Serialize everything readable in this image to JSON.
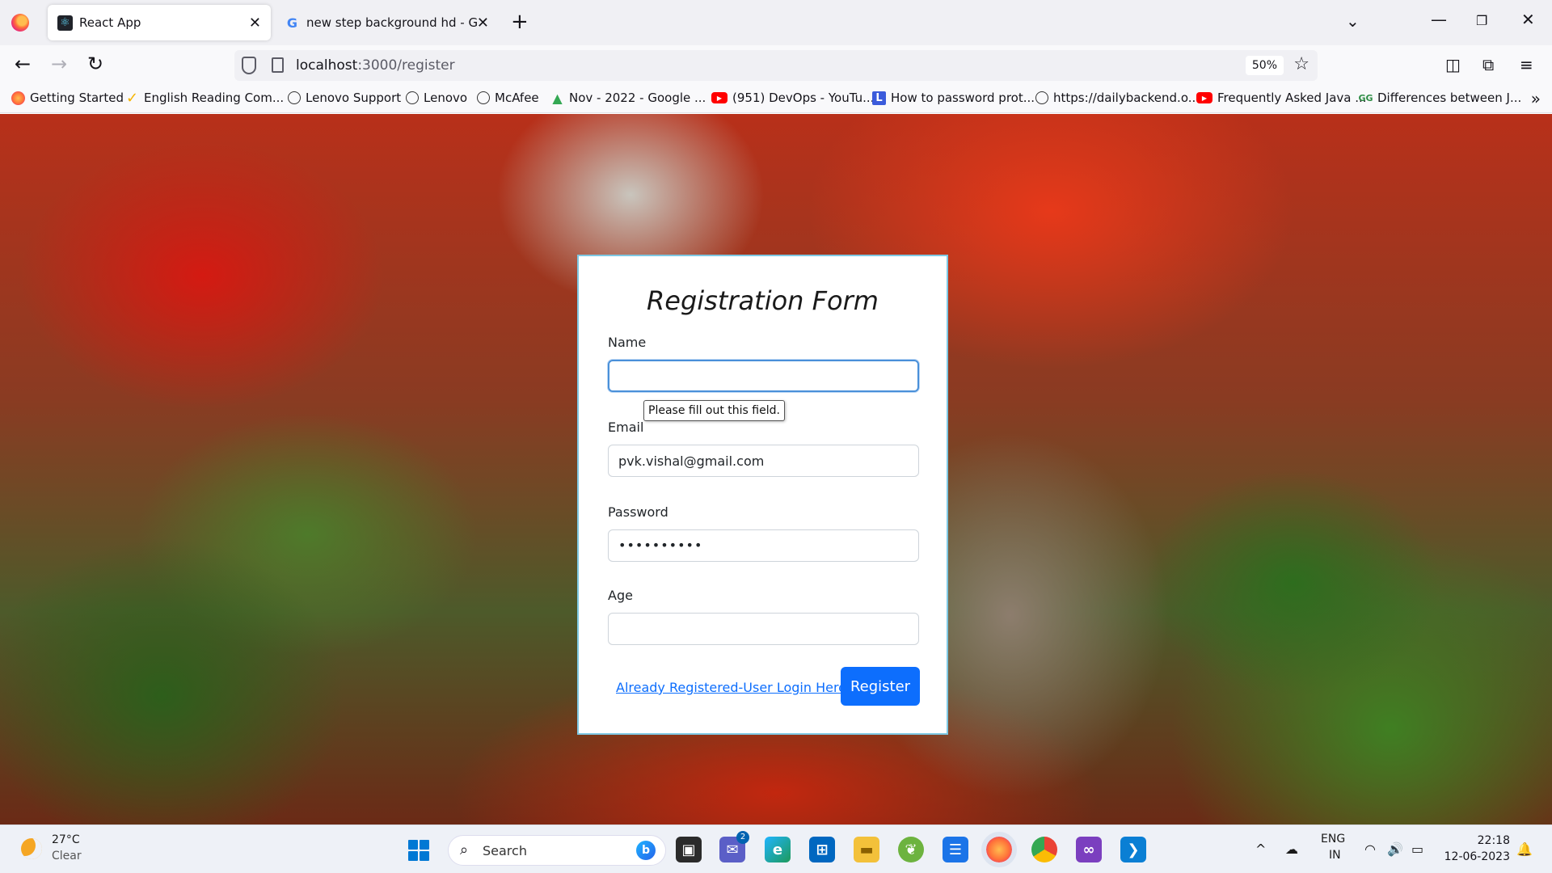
{
  "browser": {
    "tabs": [
      {
        "title": "React App",
        "icon": "react-icon",
        "active": true
      },
      {
        "title": "new step background hd - Goo",
        "icon": "google-icon",
        "active": false
      }
    ],
    "url_host": "localhost",
    "url_path": ":3000/register",
    "zoom": "50%"
  },
  "bookmarks": [
    {
      "label": "Getting Started",
      "icon": "firefox-icon"
    },
    {
      "label": "English Reading Com...",
      "icon": "check-icon"
    },
    {
      "label": "Lenovo Support",
      "icon": "globe-icon"
    },
    {
      "label": "Lenovo",
      "icon": "globe-icon"
    },
    {
      "label": "McAfee",
      "icon": "globe-icon"
    },
    {
      "label": "Nov - 2022 - Google ...",
      "icon": "google-drive-icon"
    },
    {
      "label": "(951) DevOps - YouTu...",
      "icon": "youtube-icon"
    },
    {
      "label": "How to password prot...",
      "icon": "bookmark-l-icon"
    },
    {
      "label": "https://dailybackend.o...",
      "icon": "globe-icon"
    },
    {
      "label": "Frequently Asked Java ...",
      "icon": "youtube-icon"
    },
    {
      "label": "Differences between J...",
      "icon": "geeks-icon"
    }
  ],
  "form": {
    "title": "Registration Form",
    "name_label": "Name",
    "name_value": "",
    "tooltip": "Please fill out this field.",
    "email_label": "Email",
    "email_value": "pvk.vishal@gmail.com",
    "password_label": "Password",
    "password_mask": "••••••••••",
    "age_label": "Age",
    "age_value": "",
    "login_link": "Already Registered-User Login Here",
    "register_button": "Register"
  },
  "taskbar": {
    "weather_temp": "27°C",
    "weather_cond": "Clear",
    "search_placeholder": "Search",
    "teams_badge": "2",
    "lang_top": "ENG",
    "lang_bottom": "IN",
    "time": "22:18",
    "date": "12-06-2023"
  },
  "colors": {
    "accent": "#0d6efd",
    "card_border": "#7ec8e3",
    "focus_border": "#4a90d9"
  }
}
